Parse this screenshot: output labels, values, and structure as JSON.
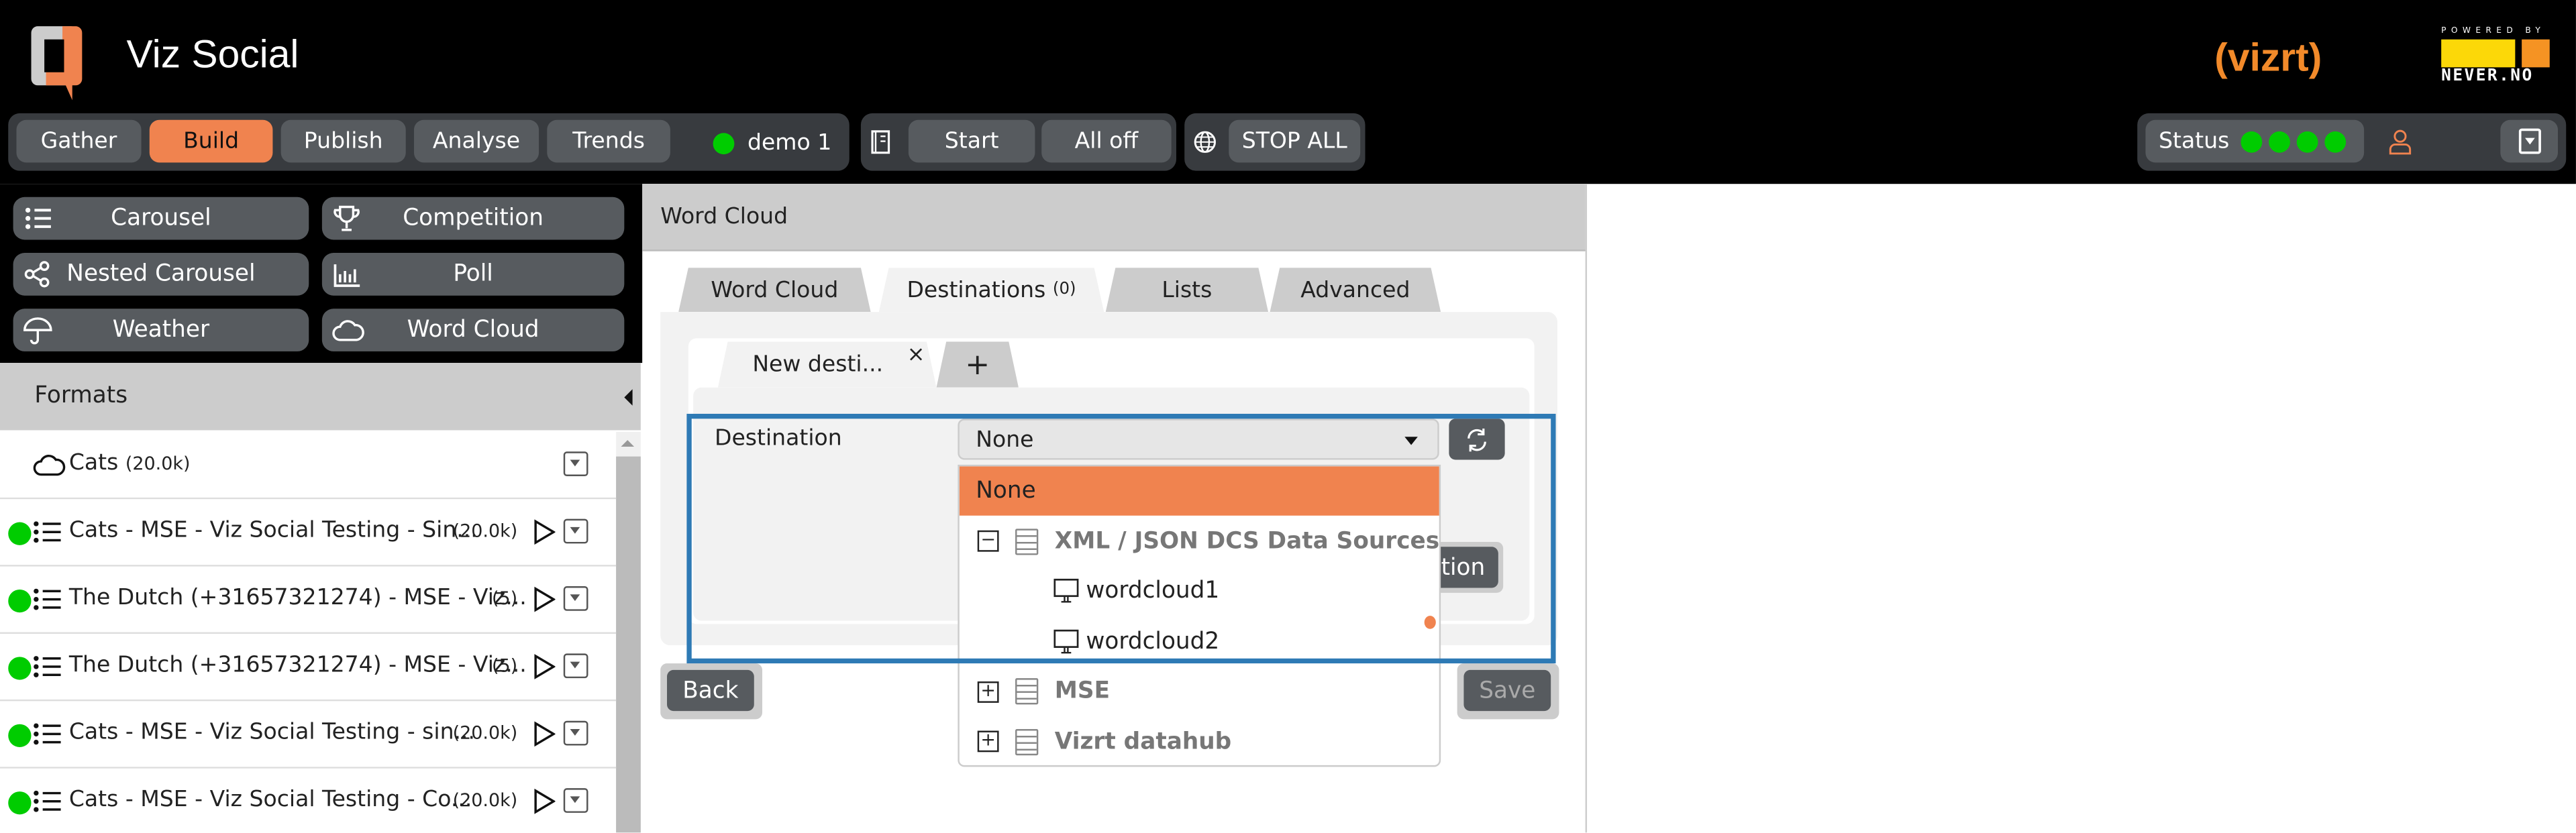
{
  "app": {
    "title": "Viz Social",
    "brand_colors": {
      "accent": "#f0834f",
      "status_ok": "#00cc00",
      "highlight": "#2e7ab5"
    },
    "logos": {
      "vizrt": "vizrt",
      "powered_by": "POWERED BY",
      "never": "NEVER.NO"
    }
  },
  "nav": {
    "items": [
      {
        "label": "Gather"
      },
      {
        "label": "Build",
        "active": true
      },
      {
        "label": "Publish"
      },
      {
        "label": "Analyse"
      },
      {
        "label": "Trends"
      }
    ],
    "profile": "demo 1"
  },
  "playout": {
    "icon": "book-icon",
    "start": "Start",
    "all_off": "All off"
  },
  "global": {
    "icon": "globe-icon",
    "stop_all": "STOP ALL"
  },
  "status": {
    "label": "Status",
    "indicators": [
      "ok",
      "ok",
      "ok",
      "ok"
    ],
    "user_icon": "user-icon",
    "menu_icon": "dropdown-icon"
  },
  "format_types": [
    {
      "label": "Carousel",
      "icon": "list-icon"
    },
    {
      "label": "Competition",
      "icon": "trophy-icon"
    },
    {
      "label": "Nested Carousel",
      "icon": "share-icon"
    },
    {
      "label": "Poll",
      "icon": "bar-chart-icon"
    },
    {
      "label": "Weather",
      "icon": "umbrella-icon"
    },
    {
      "label": "Word Cloud",
      "icon": "cloud-icon"
    }
  ],
  "formats": {
    "title": "Formats",
    "items": [
      {
        "name": "Cats",
        "count": "(20.0k)",
        "icon": "cloud-icon",
        "active": false
      },
      {
        "name": "Cats - MSE - Viz Social Testing - Sin...",
        "count": "(20.0k)",
        "active": true
      },
      {
        "name": "The Dutch (+31657321274) - MSE - Viz...",
        "count": "(5)",
        "active": true
      },
      {
        "name": "The Dutch (+31657321274) - MSE - Viz...",
        "count": "(5)",
        "active": true
      },
      {
        "name": "Cats - MSE - Viz Social Testing - sin...",
        "count": "(20.0k)",
        "active": true
      },
      {
        "name": "Cats - MSE - Viz Social Testing - Co...",
        "count": "(20.0k)",
        "active": true
      }
    ]
  },
  "editor": {
    "title": "Word Cloud",
    "tabs": [
      {
        "label": "Word Cloud"
      },
      {
        "label": "Destinations",
        "count": "(0)",
        "active": true
      },
      {
        "label": "Lists"
      },
      {
        "label": "Advanced"
      }
    ],
    "subtabs": {
      "current": "New desti...",
      "close": "×",
      "add": "+"
    },
    "destination": {
      "label": "Destination",
      "selected": "None",
      "options": [
        {
          "label": "None",
          "selected": true
        },
        {
          "label": "XML / JSON DCS Data Sources",
          "group": true,
          "expanded": true
        },
        {
          "label": "wordcloud1",
          "child": true
        },
        {
          "label": "wordcloud2",
          "child": true
        },
        {
          "label": "MSE",
          "group": true,
          "expanded": false
        },
        {
          "label": "Vizrt datahub",
          "group": true,
          "expanded": false
        }
      ]
    },
    "hidden_button_fragment": "ation",
    "back": "Back",
    "save": "Save"
  }
}
